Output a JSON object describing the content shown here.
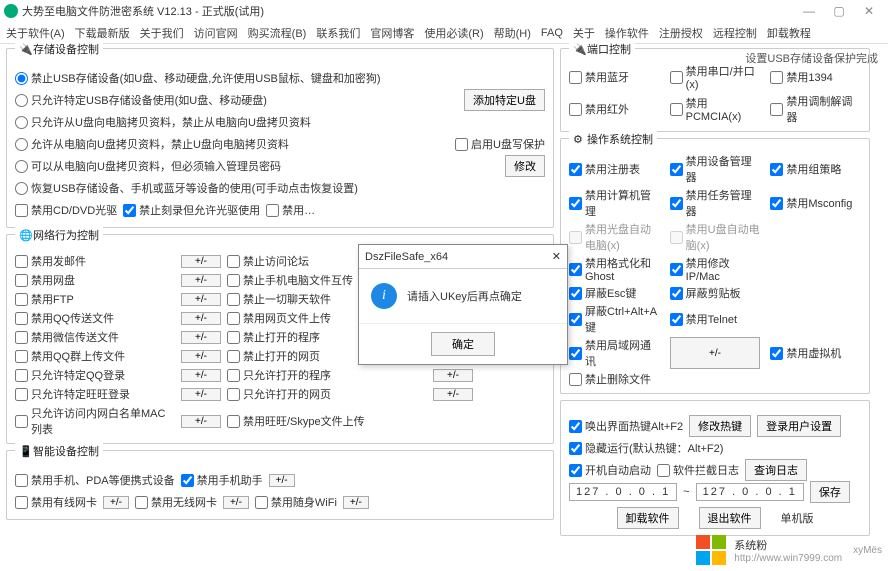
{
  "window": {
    "title": "大势至电脑文件防泄密系统 V12.13 - 正式版(试用)",
    "btn_min": "—",
    "btn_max": "▢",
    "btn_close": "✕"
  },
  "menu": [
    "关于软件(A)",
    "下载最新版",
    "关于我们",
    "访问官网",
    "购买流程(B)",
    "联系我们",
    "官网博客",
    "使用必读(R)",
    "帮助(H)",
    "FAQ",
    "关于",
    "操作软件",
    "注册授权",
    "远程控制",
    "卸载教程"
  ],
  "status_line": "设置USB存储设备保护完成",
  "storage": {
    "title": "存储设备控制",
    "r1": "禁止USB存储设备(如U盘、移动硬盘,允许使用USB鼠标、键盘和加密狗)",
    "r2": "只允许特定USB存储设备使用(如U盘、移动硬盘)",
    "btn_add_u": "添加特定U盘",
    "r3": "只允许从U盘向电脑拷贝资料，禁止从电脑向U盘拷贝资料",
    "r4": "允许从电脑向U盘拷贝资料，禁止U盘向电脑拷贝资料",
    "c_write": "启用U盘写保护",
    "r5": "可以从电脑向U盘拷贝资料，但必须输入管理员密码",
    "btn_modify": "修改",
    "r6": "恢复USB存储设备、手机或蓝牙等设备的使用(可手动点击恢复设置)",
    "c_cd": "禁用CD/DVD光驱",
    "c_burn": "禁止刻录但允许光驱使用",
    "c_extra": "禁用…"
  },
  "net": {
    "title": "网络行为控制",
    "items": [
      [
        "禁用发邮件",
        "禁止访问论坛"
      ],
      [
        "禁用网盘",
        "禁止手机电脑文件互传"
      ],
      [
        "禁用FTP",
        "禁止一切聊天软件"
      ],
      [
        "禁用QQ传送文件",
        "禁用网页文件上传"
      ],
      [
        "禁用微信传送文件",
        "禁止打开的程序"
      ],
      [
        "禁用QQ群上传文件",
        "禁止打开的网页"
      ],
      [
        "只允许特定QQ登录",
        "只允许打开的程序"
      ],
      [
        "只允许特定旺旺登录",
        "只允许打开的网页"
      ],
      [
        "只允许访问内网白名单MAC列表",
        "禁用旺旺/Skype文件上传"
      ]
    ],
    "pm": "+/-"
  },
  "smart": {
    "title": "智能设备控制",
    "c_pda": "禁用手机、PDA等便携式设备",
    "c_assist": "禁用手机助手",
    "c_wired": "禁用有线网卡",
    "c_wifi": "禁用无线网卡",
    "c_hiddenwifi": "禁用随身WiFi",
    "pm": "+/-"
  },
  "port": {
    "title": "端口控制",
    "items": [
      [
        "禁用蓝牙",
        "禁用串口/并口(x)",
        "禁用1394"
      ],
      [
        "禁用红外",
        "禁用PCMCIA(x)",
        "禁用调制解调器"
      ]
    ]
  },
  "os": {
    "title": "操作系统控制",
    "rows": [
      [
        "禁用注册表",
        "禁用设备管理器",
        "禁用组策略"
      ],
      [
        "禁用计算机管理",
        "禁用任务管理器",
        "禁用Msconfig"
      ],
      [
        "__dim:禁用光盘自动电脑(x)",
        "__dim:禁用U盘自动电脑(x)",
        ""
      ],
      [
        "禁用格式化和Ghost",
        "禁用修改IP/Mac",
        ""
      ],
      [
        "屏蔽Esc键",
        "屏蔽剪贴板",
        ""
      ],
      [
        "屏蔽Ctrl+Alt+A键",
        "禁用Telnet",
        ""
      ],
      [
        "禁用局域网通讯",
        "__pm",
        "禁用虚拟机"
      ],
      [
        "禁止删除文件",
        "",
        ""
      ]
    ],
    "pm": "+/-"
  },
  "bottom": {
    "c_hotkey": "唤出界面热键Alt+F2",
    "btn_hotkey": "修改热键",
    "btn_userset": "登录用户设置",
    "c_hide": "隐藏运行(默认热键：Alt+F2)",
    "c_autostart": "开机自动启动",
    "c_blocklog": "软件拦截日志",
    "btn_log": "查询日志",
    "ip1": "127 . 0 . 0 . 1",
    "ip_sep": "~",
    "ip2": "127 . 0 . 0 . 1",
    "btn_save": "保存",
    "btn_uninstall": "卸载软件",
    "btn_exit": "退出软件",
    "lbl_single": "单机版"
  },
  "modal": {
    "title": "DszFileSafe_x64",
    "msg": "请插入UKey后再点确定",
    "ok": "确定",
    "close": "✕"
  },
  "watermark": {
    "brand": "系统粉",
    "url": "http://www.win7999.com",
    "sig": "xyMës"
  }
}
